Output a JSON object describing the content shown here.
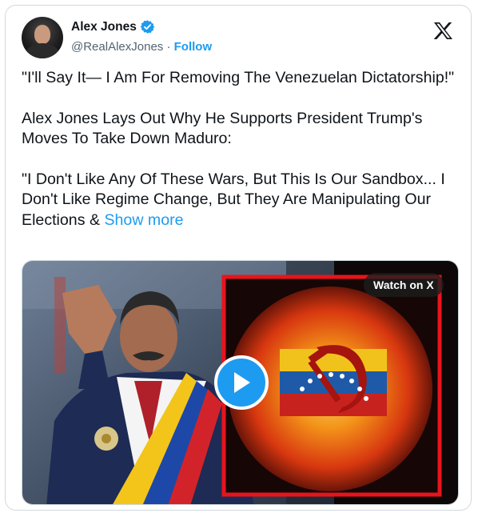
{
  "author": {
    "name": "Alex Jones",
    "handle": "@RealAlexJones",
    "separator": "·",
    "follow_label": "Follow"
  },
  "tweet": {
    "paragraphs": [
      "\"I'll Say It— I Am For Removing The Venezuelan Dictatorship!\"",
      "Alex Jones Lays Out Why He Supports President Trump's Moves To Take Down Maduro:"
    ],
    "last_paragraph": "\"I Don't Like Any Of These Wars, But This Is Our Sandbox... I Don't Like Regime Change, But They Are Manipulating Our Elections & ",
    "show_more_label": "Show more"
  },
  "media": {
    "watch_label": "Watch on X"
  },
  "icons": {
    "verified": "verified-badge-icon",
    "x_logo": "x-logo-icon",
    "play": "play-icon"
  },
  "colors": {
    "accent": "#1d9bf0",
    "text": "#0f1419",
    "muted": "#536471",
    "border": "#cfd9de"
  }
}
